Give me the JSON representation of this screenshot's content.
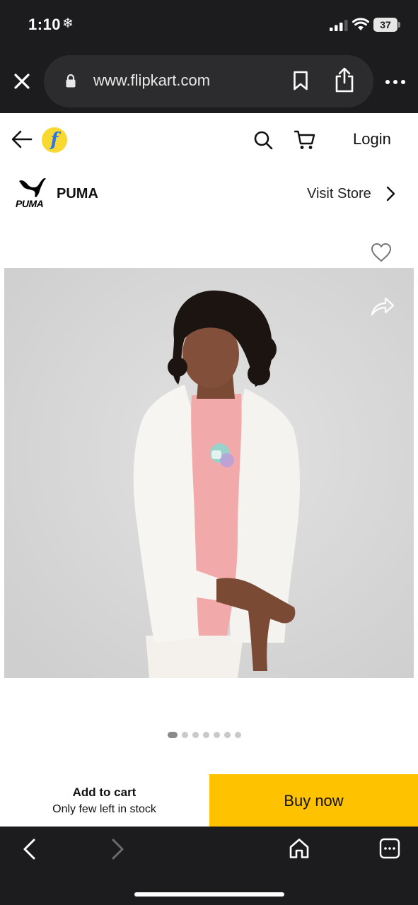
{
  "status_bar": {
    "time": "1:10",
    "battery": "37"
  },
  "browser": {
    "url": "www.flipkart.com"
  },
  "header": {
    "login_label": "Login"
  },
  "brand": {
    "logo_text": "PUMA",
    "name": "PUMA",
    "visit_store_label": "Visit Store"
  },
  "gallery": {
    "image_count": 7,
    "active_index": 0
  },
  "actions": {
    "add_to_cart_label": "Add to cart",
    "stock_note": "Only few left in stock",
    "buy_now_label": "Buy now"
  },
  "colors": {
    "buy_now": "#ffc200",
    "flipkart_blue": "#2874f0",
    "flipkart_yellow": "#f9d92f",
    "chrome_dark": "#1c1c1e"
  },
  "icons": [
    "snowflake-icon",
    "signal-icon",
    "wifi-icon",
    "battery-icon",
    "close-icon",
    "lock-icon",
    "bookmark-icon",
    "share-icon",
    "more-icon",
    "back-arrow-icon",
    "search-icon",
    "cart-icon",
    "chevron-right-icon",
    "heart-icon",
    "share-arrow-icon",
    "nav-back-icon",
    "nav-forward-icon",
    "home-icon",
    "tabs-icon"
  ]
}
